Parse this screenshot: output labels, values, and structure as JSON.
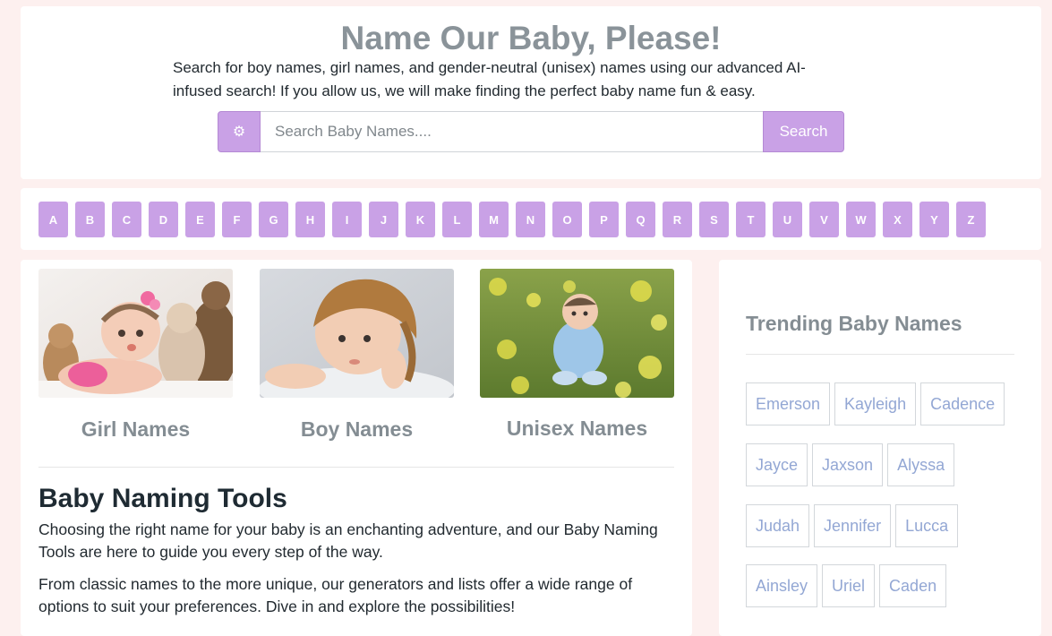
{
  "header": {
    "title": "Name Our Baby, Please!",
    "intro": "Search for boy names, girl names, and gender-neutral (unisex) names using our advanced AI-infused search! If you allow us, we will make finding the perfect baby name fun & easy.",
    "search_options_icon": "gear-icon",
    "search_placeholder": "Search Baby Names....",
    "search_button": "Search"
  },
  "alphabet": [
    "A",
    "B",
    "C",
    "D",
    "E",
    "F",
    "G",
    "H",
    "I",
    "J",
    "K",
    "L",
    "M",
    "N",
    "O",
    "P",
    "Q",
    "R",
    "S",
    "T",
    "U",
    "V",
    "W",
    "X",
    "Y",
    "Z"
  ],
  "categories": [
    {
      "label": "Girl Names"
    },
    {
      "label": "Boy Names"
    },
    {
      "label": "Unisex Names"
    }
  ],
  "tools": {
    "title": "Baby Naming Tools",
    "p1": "Choosing the right name for your baby is an enchanting adventure, and our Baby Naming Tools are here to guide you every step of the way.",
    "p2": "From classic names to the more unique, our generators and lists offer a wide range of options to suit your preferences. Dive in and explore the possibilities!"
  },
  "trending": {
    "title": "Trending Baby Names",
    "rows": [
      [
        "Emerson",
        "Kayleigh",
        "Cadence"
      ],
      [
        "Jayce",
        "Jaxson",
        "Alyssa"
      ],
      [
        "Judah",
        "Jennifer",
        "Lucca"
      ],
      [
        "Ainsley",
        "Uriel",
        "Caden"
      ]
    ]
  },
  "colors": {
    "accent": "#c9a1e6",
    "page_bg": "#fdf0ef",
    "heading_gray": "#848d93",
    "chip_text": "#93a7d4"
  }
}
